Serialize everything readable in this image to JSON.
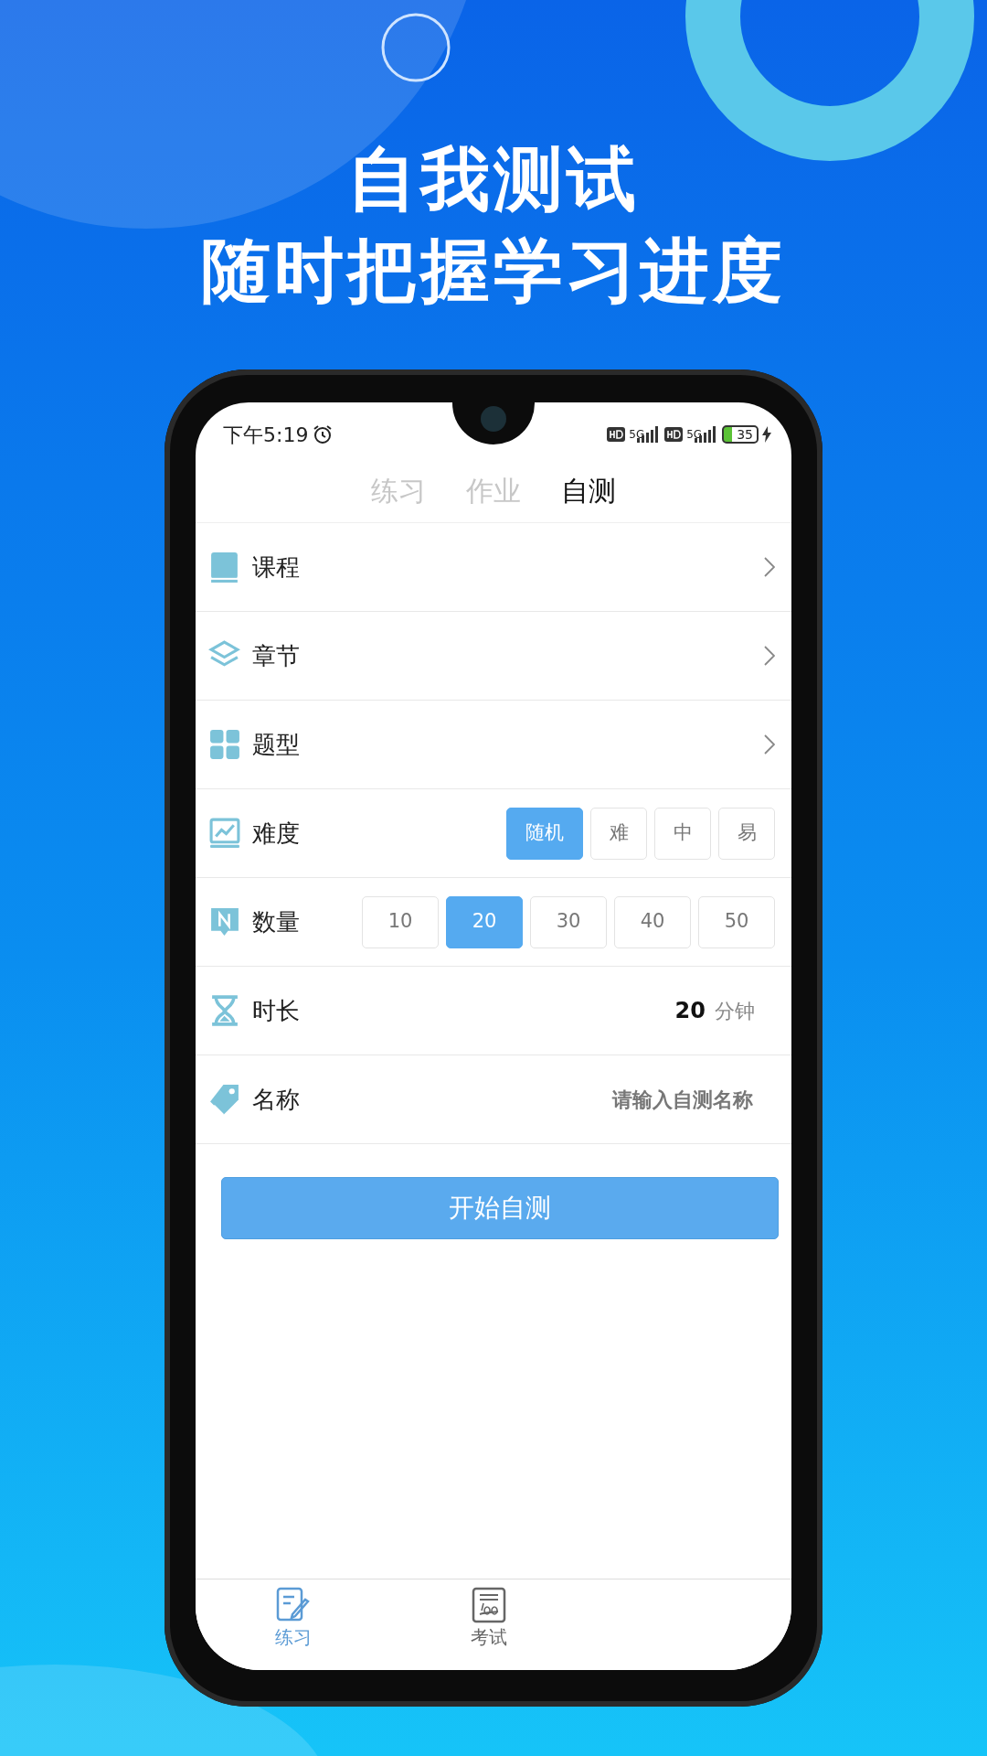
{
  "headline": [
    "自我测试",
    "随时把握学习进度"
  ],
  "status_bar": {
    "time": "下午5:19",
    "network_labels": [
      "5G",
      "5G"
    ],
    "battery": "35"
  },
  "tabs": [
    {
      "label": "练习",
      "selected": false
    },
    {
      "label": "作业",
      "selected": false
    },
    {
      "label": "自测",
      "selected": true
    }
  ],
  "rows": [
    {
      "kind": "nav",
      "label": "课程"
    },
    {
      "kind": "nav",
      "label": "章节"
    },
    {
      "kind": "nav",
      "label": "题型"
    },
    {
      "kind": "options",
      "label": "难度",
      "options": [
        {
          "label": "随机",
          "selected": true
        },
        {
          "label": "难",
          "selected": false
        },
        {
          "label": "中",
          "selected": false
        },
        {
          "label": "易",
          "selected": false
        }
      ]
    },
    {
      "kind": "options",
      "label": "数量",
      "options": [
        {
          "label": "10",
          "selected": false
        },
        {
          "label": "20",
          "selected": true
        },
        {
          "label": "30",
          "selected": false
        },
        {
          "label": "40",
          "selected": false
        },
        {
          "label": "50",
          "selected": false
        }
      ]
    },
    {
      "kind": "value",
      "label": "时长",
      "value": "20",
      "unit": "分钟"
    },
    {
      "kind": "input",
      "label": "名称",
      "placeholder": "请输入自测名称"
    }
  ],
  "start_button": "开始自测",
  "bottom_nav": [
    {
      "label": "练习",
      "selected": true
    },
    {
      "label": "考试",
      "selected": false
    }
  ]
}
